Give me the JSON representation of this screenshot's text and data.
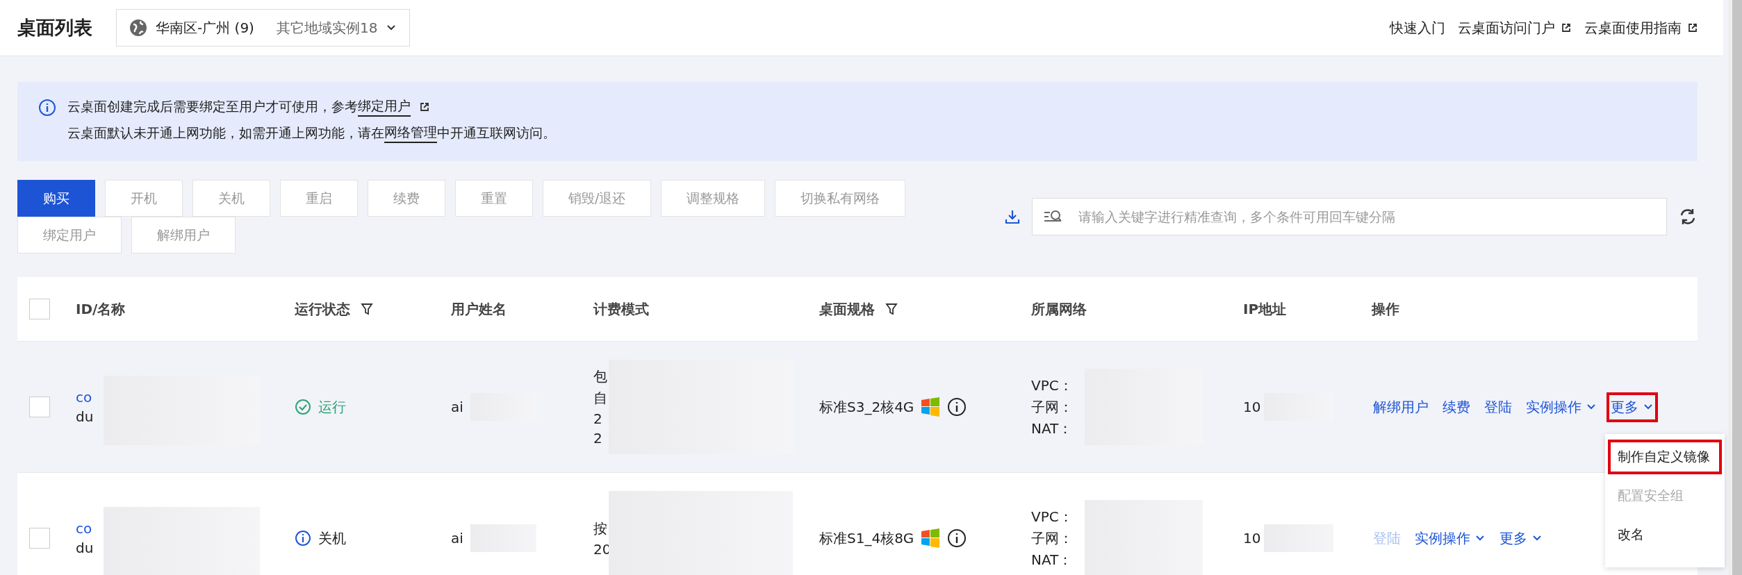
{
  "header": {
    "title": "桌面列表",
    "region": {
      "name": "华南区-广州 (9)",
      "other": "其它地域实例18"
    },
    "links": [
      {
        "label": "快速入门",
        "external": false
      },
      {
        "label": "云桌面访问门户",
        "external": true
      },
      {
        "label": "云桌面使用指南",
        "external": true
      }
    ]
  },
  "notice": {
    "lines": [
      {
        "before": "云桌面创建完成后需要绑定至用户才可使用，参考",
        "link": "绑定用户",
        "external": true
      },
      {
        "before": "云桌面默认未开通上网功能，如需开通上网功能，请在",
        "link": "网络管理",
        "after": "中开通互联网访问。",
        "external": false
      }
    ]
  },
  "toolbar": {
    "buttons": [
      {
        "label": "购买",
        "primary": true
      },
      {
        "label": "开机",
        "primary": false
      },
      {
        "label": "关机",
        "primary": false
      },
      {
        "label": "重启",
        "primary": false
      },
      {
        "label": "续费",
        "primary": false
      },
      {
        "label": "重置",
        "primary": false
      },
      {
        "label": "销毁/退还",
        "primary": false
      },
      {
        "label": "调整规格",
        "primary": false
      },
      {
        "label": "切换私有网络",
        "primary": false
      },
      {
        "label": "绑定用户",
        "primary": false
      },
      {
        "label": "解绑用户",
        "primary": false
      }
    ],
    "search": {
      "placeholder": "请输入关键字进行精准查询，多个条件可用回车键分隔"
    }
  },
  "table": {
    "select_all": {
      "checked": false
    },
    "columns": [
      {
        "label": "ID/名称",
        "filter": false
      },
      {
        "label": "运行状态",
        "filter": true
      },
      {
        "label": "用户姓名",
        "filter": false
      },
      {
        "label": "计费模式",
        "filter": false
      },
      {
        "label": "桌面规格",
        "filter": true
      },
      {
        "label": "所属网络",
        "filter": false
      },
      {
        "label": "IP地址",
        "filter": false
      },
      {
        "label": "操作",
        "filter": false
      }
    ],
    "rows": [
      {
        "checked": false,
        "hovered": true,
        "id": "co",
        "name": "du",
        "status": {
          "kind": "running",
          "label": "运行"
        },
        "user": "ai",
        "billing": [
          "包",
          "自",
          "2",
          "2"
        ],
        "spec": "标准S3_2核4G",
        "network": [
          "VPC：",
          "子网：",
          "NAT："
        ],
        "ip": "10",
        "actions": [
          {
            "label": "解绑用户",
            "disabled": false,
            "caret": false,
            "highlighted": false
          },
          {
            "label": "续费",
            "disabled": false,
            "caret": false,
            "highlighted": false
          },
          {
            "label": "登陆",
            "disabled": false,
            "caret": false,
            "highlighted": false
          },
          {
            "label": "实例操作",
            "disabled": false,
            "caret": true,
            "highlighted": false
          },
          {
            "label": "更多",
            "disabled": false,
            "caret": true,
            "highlighted": true
          }
        ]
      },
      {
        "checked": false,
        "hovered": false,
        "id": "co",
        "name": "du",
        "status": {
          "kind": "stopped",
          "label": "关机"
        },
        "user": "ai",
        "billing": [
          "按",
          "20"
        ],
        "spec": "标准S1_4核8G",
        "network": [
          "VPC：",
          "子网：",
          "NAT："
        ],
        "ip": "10",
        "actions": [
          {
            "label": "登陆",
            "disabled": true,
            "caret": false,
            "highlighted": false
          },
          {
            "label": "实例操作",
            "disabled": false,
            "caret": true,
            "highlighted": false
          },
          {
            "label": "更多",
            "disabled": false,
            "caret": true,
            "highlighted": false
          }
        ]
      }
    ]
  },
  "menu": {
    "items": [
      {
        "label": "制作自定义镜像",
        "disabled": false,
        "highlighted": true
      },
      {
        "label": "配置安全组",
        "disabled": true,
        "highlighted": false
      },
      {
        "label": "改名",
        "disabled": false,
        "highlighted": false
      }
    ]
  }
}
